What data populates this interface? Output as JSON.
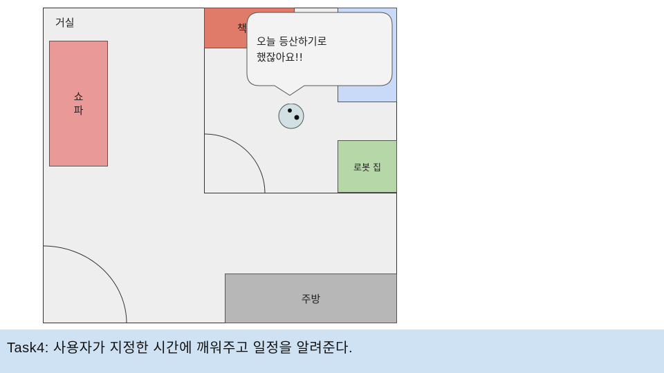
{
  "floor_plan": {
    "living_room_label": "거실",
    "sofa_label": "쇼파",
    "desk_label_partial": "책",
    "robot_home_label": "로봇 집",
    "kitchen_label": "주방"
  },
  "speech_bubble": {
    "text": "오늘 등산하기로\n했잖아요!!"
  },
  "robot": {
    "icon": "robot-vacuum-icon"
  },
  "task": {
    "text": "Task4: 사용자가 지정한 시간에 깨워주고 일정을 알려준다."
  },
  "colors": {
    "sofa": "#ea9999",
    "desk": "#e07b6a",
    "blue_furniture": "#c9daf8",
    "robot_home": "#b6d7a8",
    "kitchen": "#b7b7b7",
    "task_bar": "#cfe2f3",
    "robot": "#d0e0e3"
  }
}
